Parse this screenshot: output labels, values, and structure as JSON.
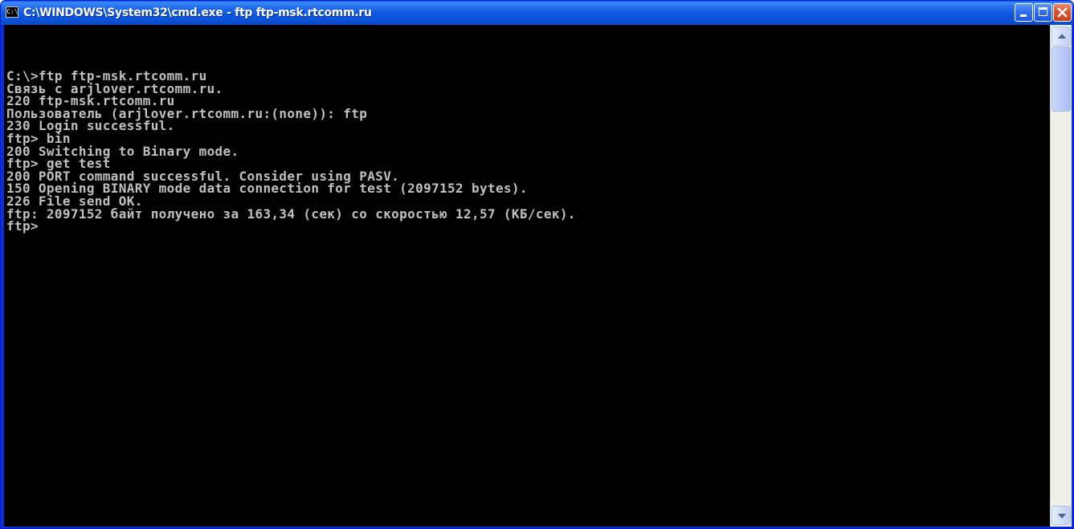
{
  "window": {
    "title": "C:\\WINDOWS\\System32\\cmd.exe - ftp ftp-msk.rtcomm.ru",
    "icon": "cmd-icon",
    "icon_text": "C:\\",
    "buttons": {
      "minimize": "minimize-icon",
      "maximize": "maximize-icon",
      "close": "close-icon"
    }
  },
  "colors": {
    "titlebar": "#0b55da",
    "console_bg": "#000000",
    "console_text": "#c0c0c0",
    "close_button": "#d9542c"
  },
  "console": {
    "lines": [
      "C:\\>ftp ftp-msk.rtcomm.ru",
      "Связь с arjlover.rtcomm.ru.",
      "220 ftp-msk.rtcomm.ru",
      "Пользователь (arjlover.rtcomm.ru:(none)): ftp",
      "230 Login successful.",
      "ftp> bin",
      "200 Switching to Binary mode.",
      "ftp> get test",
      "200 PORT command successful. Consider using PASV.",
      "150 Opening BINARY mode data connection for test (2097152 bytes).",
      "226 File send OK.",
      "ftp: 2097152 байт получено за 163,34 (сек) со скоростью 12,57 (КБ/сек).",
      "ftp>"
    ]
  },
  "scrollbar": {
    "up_icon": "scroll-up-arrow-icon",
    "down_icon": "scroll-down-arrow-icon"
  }
}
